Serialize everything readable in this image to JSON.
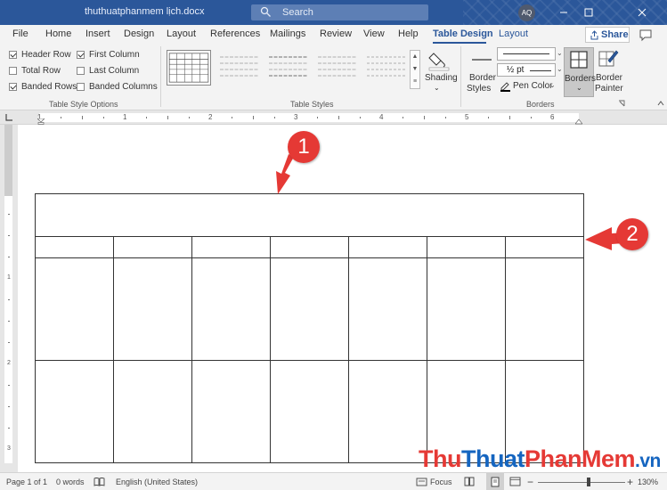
{
  "title_bar": {
    "document_title": "thuthuatphanmem lịch.docx",
    "search_placeholder": "Search",
    "user_initials": "AQ",
    "controls": [
      "minimize-icon",
      "restore-icon",
      "close-icon"
    ]
  },
  "menu": {
    "tabs": [
      {
        "label": "File"
      },
      {
        "label": "Home"
      },
      {
        "label": "Insert"
      },
      {
        "label": "Design"
      },
      {
        "label": "Layout"
      },
      {
        "label": "References"
      },
      {
        "label": "Mailings"
      },
      {
        "label": "Review"
      },
      {
        "label": "View"
      },
      {
        "label": "Help"
      },
      {
        "label": "Table Design",
        "active": true
      },
      {
        "label": "Layout"
      }
    ],
    "share_label": "Share"
  },
  "ribbon": {
    "style_options": {
      "header_row": {
        "label": "Header Row",
        "checked": true
      },
      "first_column": {
        "label": "First Column",
        "checked": true
      },
      "total_row": {
        "label": "Total Row",
        "checked": false
      },
      "last_column": {
        "label": "Last Column",
        "checked": false
      },
      "banded_rows": {
        "label": "Banded Rows",
        "checked": true
      },
      "banded_columns": {
        "label": "Banded Columns",
        "checked": false
      },
      "group_label": "Table Style Options"
    },
    "table_styles": {
      "group_label": "Table Styles"
    },
    "shading_label": "Shading",
    "borders": {
      "border_styles_label_1": "Border",
      "border_styles_label_2": "Styles",
      "pen_weight": "½ pt",
      "pen_color_label": "Pen Color",
      "borders_label": "Borders",
      "border_painter_1": "Border",
      "border_painter_2": "Painter",
      "group_label": "Borders"
    }
  },
  "ruler": {
    "h_numbers": [
      "1",
      "1",
      "2",
      "3",
      "4",
      "5",
      "6"
    ],
    "v_numbers": [
      "1",
      "2",
      "3"
    ]
  },
  "annotations": {
    "badge_1": "1",
    "badge_2": "2"
  },
  "status_bar": {
    "page": "Page 1 of 1",
    "words": "0 words",
    "language": "English (United States)",
    "focus": "Focus",
    "zoom": "130%"
  },
  "watermark": {
    "part1": "Thu",
    "part2": "Thuat",
    "part3": "PhanMem",
    "part4": ".vn"
  },
  "colors": {
    "accent": "#2b579a",
    "badge": "#e53935"
  }
}
